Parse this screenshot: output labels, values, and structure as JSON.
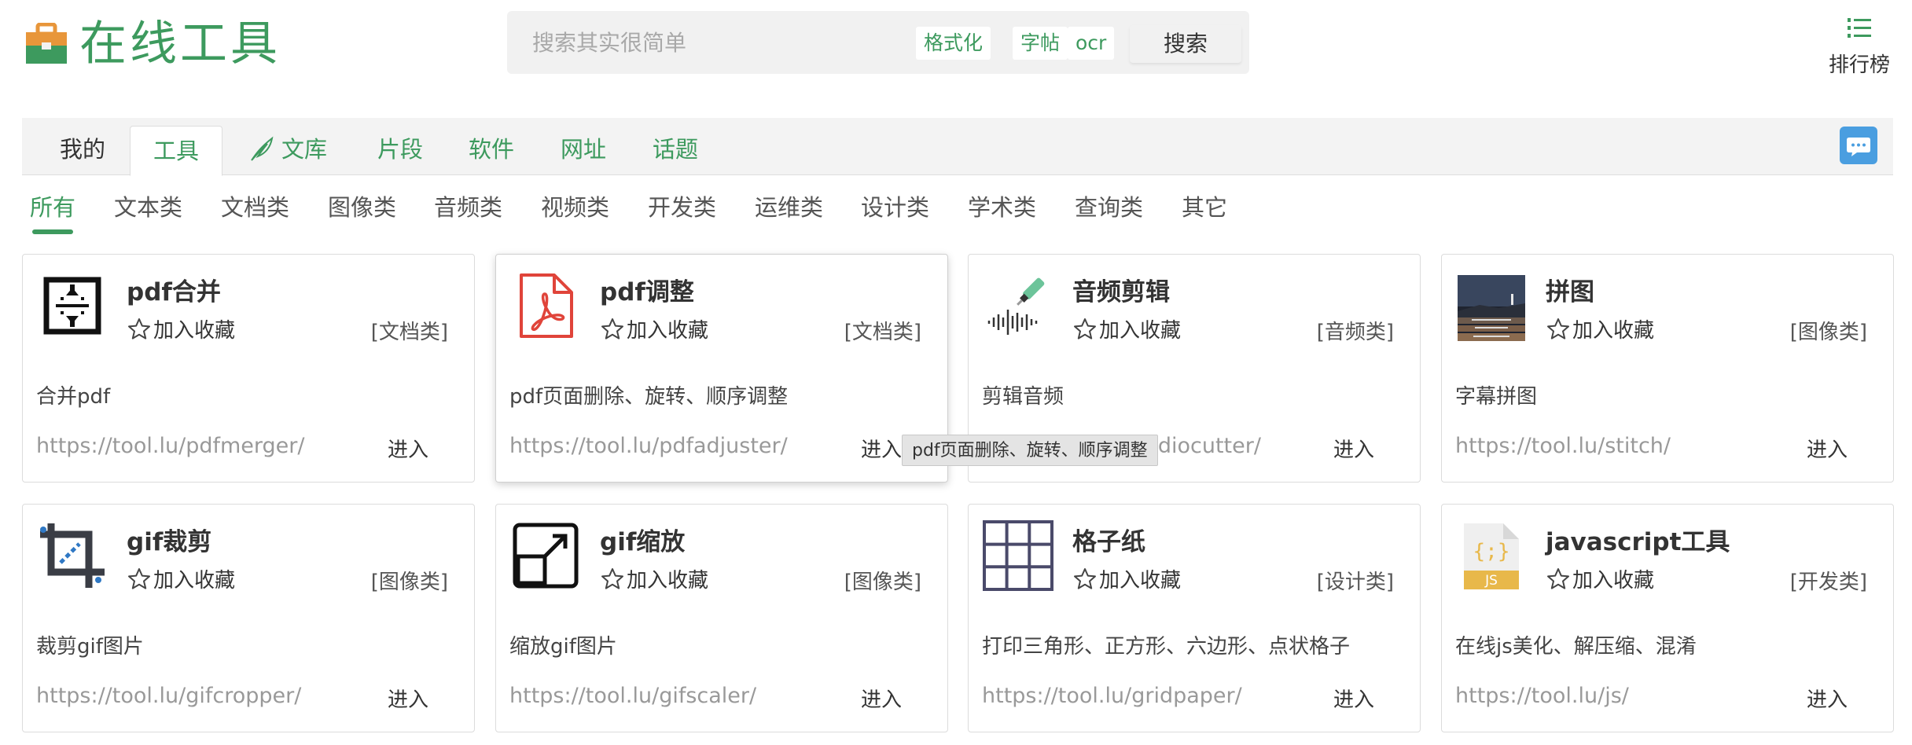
{
  "header": {
    "site_title": "在线工具",
    "search": {
      "placeholder": "搜索其实很简单",
      "value": ""
    },
    "quick_chips": [
      "格式化",
      "字帖",
      "ocr"
    ],
    "search_button": "搜索",
    "rank_label": "排行榜"
  },
  "tabs": [
    {
      "label": "我的",
      "state": "normal"
    },
    {
      "label": "工具",
      "state": "active"
    },
    {
      "label": "文库",
      "state": "normal",
      "icon": "feather-icon"
    },
    {
      "label": "片段",
      "state": "normal"
    },
    {
      "label": "软件",
      "state": "normal"
    },
    {
      "label": "网址",
      "state": "normal"
    },
    {
      "label": "话题",
      "state": "normal"
    }
  ],
  "categories": [
    "所有",
    "文本类",
    "文档类",
    "图像类",
    "音频类",
    "视频类",
    "开发类",
    "运维类",
    "设计类",
    "学术类",
    "查询类",
    "其它"
  ],
  "active_category": "所有",
  "fav_label": "加入收藏",
  "enter_label": "进入",
  "cards": [
    {
      "title": "pdf合并",
      "category": "[文档类]",
      "desc": "合并pdf",
      "url": "https://tool.lu/pdfmerger/",
      "icon": "pdf-merge-icon"
    },
    {
      "title": "pdf调整",
      "category": "[文档类]",
      "desc": "pdf页面删除、旋转、顺序调整",
      "url": "https://tool.lu/pdfadjuster/",
      "icon": "pdf-icon"
    },
    {
      "title": "音频剪辑",
      "category": "[音频类]",
      "desc": "剪辑音频",
      "url": "https://tool.lu/audiocutter/",
      "icon": "audio-cut-icon"
    },
    {
      "title": "拼图",
      "category": "[图像类]",
      "desc": "字幕拼图",
      "url": "https://tool.lu/stitch/",
      "icon": "stitch-thumbnail-icon"
    },
    {
      "title": "gif裁剪",
      "category": "[图像类]",
      "desc": "裁剪gif图片",
      "url": "https://tool.lu/gifcropper/",
      "icon": "crop-icon"
    },
    {
      "title": "gif缩放",
      "category": "[图像类]",
      "desc": "缩放gif图片",
      "url": "https://tool.lu/gifscaler/",
      "icon": "resize-icon"
    },
    {
      "title": "格子纸",
      "category": "[设计类]",
      "desc": "打印三角形、正方形、六边形、点状格子",
      "url": "https://tool.lu/gridpaper/",
      "icon": "grid-icon"
    },
    {
      "title": "javascript工具",
      "category": "[开发类]",
      "desc": "在线js美化、解压缩、混淆",
      "url": "https://tool.lu/js/",
      "icon": "js-file-icon"
    }
  ],
  "tooltip": "pdf页面删除、旋转、顺序调整",
  "colors": {
    "brand_green": "#3d9a5e",
    "chat_blue": "#4a9ee0",
    "pdf_red": "#e0443a"
  }
}
